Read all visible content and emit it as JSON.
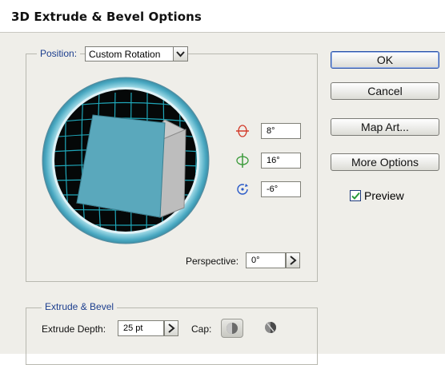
{
  "window": {
    "title": "3D Extrude & Bevel Options"
  },
  "position": {
    "legend": "Position:",
    "select_value": "Custom Rotation",
    "rotation_x": "8°",
    "rotation_y": "16°",
    "rotation_z": "-6°",
    "perspective_label": "Perspective:",
    "perspective_value": "0°"
  },
  "buttons": {
    "ok": "OK",
    "cancel": "Cancel",
    "map_art": "Map Art...",
    "more_options": "More Options"
  },
  "preview": {
    "label": "Preview",
    "checked": true
  },
  "extrude": {
    "legend": "Extrude & Bevel",
    "depth_label": "Extrude Depth:",
    "depth_value": "25 pt",
    "cap_label": "Cap:"
  },
  "colors": {
    "legend_text": "#1c3e8e",
    "cube_front": "#5aa8bc",
    "cube_side": "#c8c8c8",
    "grid": "#1fa6b8",
    "axis_x": "#d23a2a",
    "axis_y": "#3a9a3a",
    "axis_z": "#2a5ac8"
  },
  "icons": [
    "dropdown-arrow-icon",
    "rotate-x-axis-icon",
    "rotate-y-axis-icon",
    "rotate-z-axis-icon",
    "stepper-arrow-icon",
    "cap-on-icon",
    "cap-off-icon",
    "checkmark-icon"
  ]
}
